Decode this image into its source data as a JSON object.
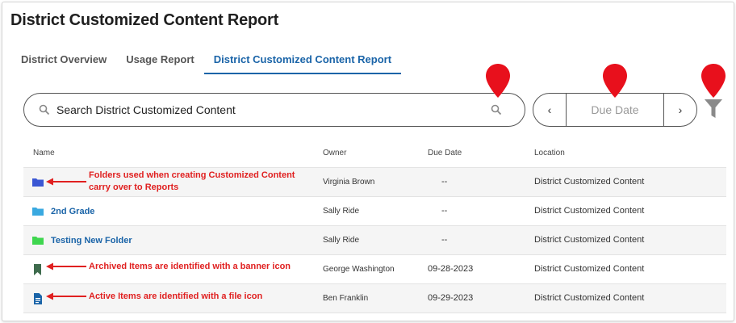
{
  "page": {
    "title": "District Customized Content Report"
  },
  "tabs": [
    {
      "label": "District Overview",
      "active": false
    },
    {
      "label": "Usage Report",
      "active": false
    },
    {
      "label": "District Customized Content Report",
      "active": true
    }
  ],
  "search": {
    "placeholder": "Search District Customized Content",
    "value": ""
  },
  "date_picker": {
    "label": "Due Date",
    "prev_symbol": "‹",
    "next_symbol": "›"
  },
  "table": {
    "columns": [
      "Name",
      "Owner",
      "Due Date",
      "Location"
    ],
    "rows": [
      {
        "icon": "folder-icon",
        "icon_color": "#3b57d4",
        "name": "",
        "owner": "Virginia Brown",
        "due_date": "--",
        "location": "District Customized Content"
      },
      {
        "icon": "folder-icon",
        "icon_color": "#3aa9e0",
        "name": "2nd Grade",
        "owner": "Sally Ride",
        "due_date": "--",
        "location": "District Customized Content"
      },
      {
        "icon": "folder-icon",
        "icon_color": "#3fd64f",
        "name": "Testing New Folder",
        "owner": "Sally Ride",
        "due_date": "--",
        "location": "District Customized Content"
      },
      {
        "icon": "banner-icon",
        "icon_color": "#3e6b4d",
        "name": "",
        "owner": "George Washington",
        "due_date": "09-28-2023",
        "location": "District Customized Content"
      },
      {
        "icon": "file-icon",
        "icon_color": "#1a64a8",
        "name": "",
        "owner": "Ben Franklin",
        "due_date": "09-29-2023",
        "location": "District Customized Content"
      }
    ]
  },
  "annotations": {
    "folders_line1": "Folders used when creating Customized Content",
    "folders_line2": "carry over to Reports",
    "archived": "Archived Items are identified with a banner icon",
    "active": "Active Items are identified with a file icon"
  },
  "colors": {
    "accent": "#1a64a8",
    "annotation": "#e02020",
    "pin": "#e8101c"
  }
}
